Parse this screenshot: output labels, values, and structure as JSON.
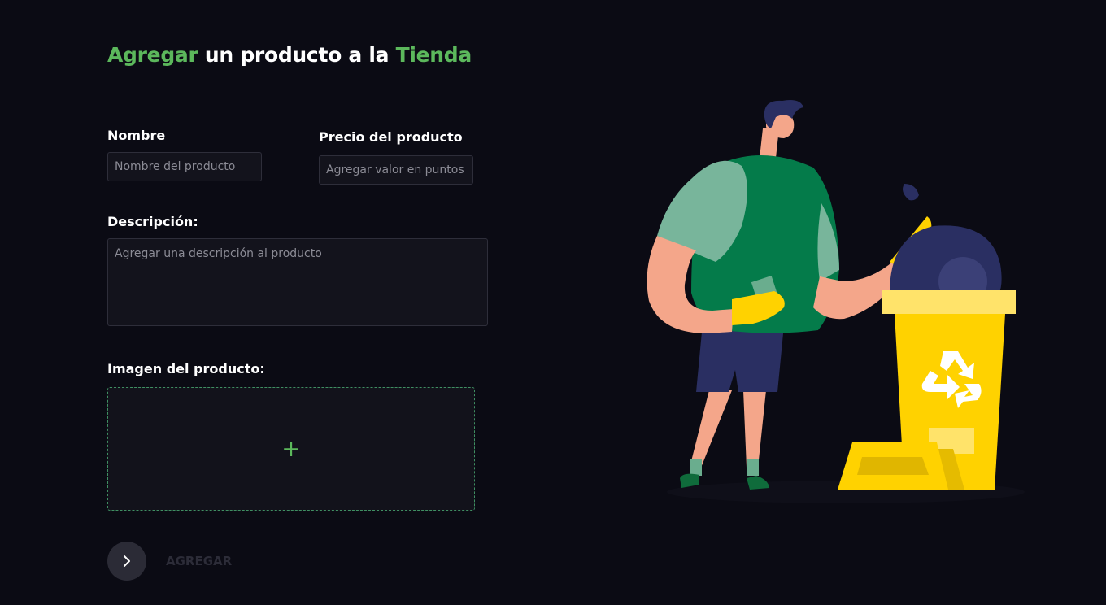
{
  "title": {
    "part1": "Agregar",
    "part2": " un producto a la ",
    "part3": "Tienda"
  },
  "form": {
    "name_label": "Nombre",
    "name_placeholder": "Nombre del producto",
    "price_label": "Precio del producto",
    "price_placeholder": "Agregar valor en puntos",
    "description_label": "Descripción:",
    "description_placeholder": "Agregar una descripción al producto",
    "image_label": "Imagen del producto:",
    "image_add_icon": "plus-icon",
    "submit_icon": "chevron-right-icon",
    "submit_label": "AGREGAR"
  },
  "illustration": {
    "icon": "recycling-person-illustration"
  },
  "colors": {
    "background": "#0b0b14",
    "accent": "#5cb85c",
    "bin_yellow": "#ffd200"
  }
}
